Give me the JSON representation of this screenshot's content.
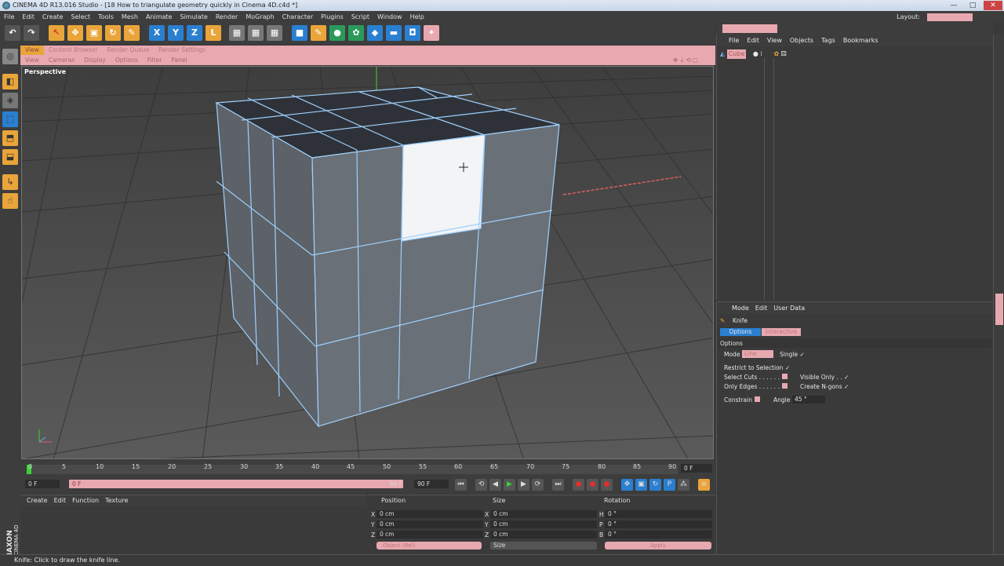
{
  "window": {
    "title": "CINEMA 4D R13.016 Studio - [18 How to triangulate geometry quickly in Cinema 4D.c4d *]",
    "minimize": "—",
    "maximize": "□",
    "close": "✕"
  },
  "menubar": [
    "File",
    "Edit",
    "Create",
    "Select",
    "Tools",
    "Mesh",
    "Animate",
    "Simulate",
    "Render",
    "MoGraph",
    "Character",
    "Plugins",
    "Script",
    "Window",
    "Help"
  ],
  "layout_label": "Layout:",
  "toolbar": {
    "undo": "↶",
    "redo": "↷",
    "live_select": "↖",
    "move": "✥",
    "scale": "▣",
    "rotate": "↻",
    "recent": "✎",
    "x_axis": "X",
    "y_axis": "Y",
    "z_axis": "Z",
    "coord_system": "L"
  },
  "viewport_tabs": [
    "View",
    "Content Browser",
    "Render Queue",
    "Render Settings"
  ],
  "viewport_menu": [
    "View",
    "Cameras",
    "Display",
    "Options",
    "Filter",
    "Panel"
  ],
  "viewport": {
    "label": "Perspective",
    "nav_icons": "✥⇣⟲▢"
  },
  "timeline": {
    "ticks": [
      "0",
      "5",
      "10",
      "15",
      "20",
      "25",
      "30",
      "35",
      "40",
      "45",
      "50",
      "55",
      "60",
      "65",
      "70",
      "75",
      "80",
      "85",
      "90"
    ],
    "frame_field": "0 F"
  },
  "transport": {
    "start": "0 F",
    "current": "0 F",
    "end1": "90 F",
    "end2": "90 F"
  },
  "material_manager": {
    "menu": [
      "Create",
      "Edit",
      "Function",
      "Texture"
    ]
  },
  "coordinates": {
    "headers": {
      "position": "Position",
      "size": "Size",
      "rotation": "Rotation"
    },
    "rows": [
      {
        "axis": "X",
        "pos": "0 cm",
        "saxis": "X",
        "size": "0 cm",
        "raxis": "H",
        "rot": "0 °"
      },
      {
        "axis": "Y",
        "pos": "0 cm",
        "saxis": "Y",
        "size": "0 cm",
        "raxis": "P",
        "rot": "0 °"
      },
      {
        "axis": "Z",
        "pos": "0 cm",
        "saxis": "Z",
        "size": "0 cm",
        "raxis": "B",
        "rot": "0 °"
      }
    ],
    "size_mode": "Size",
    "object_mode": "Object (Rel)",
    "apply": "Apply"
  },
  "object_manager": {
    "menu": [
      "File",
      "Edit",
      "View",
      "Objects",
      "Tags",
      "Bookmarks"
    ],
    "object": "Cube"
  },
  "attribute_manager": {
    "menu": [
      "Mode",
      "Edit",
      "User Data"
    ],
    "tool": "Knife",
    "tabs": [
      "Options",
      "Interactive"
    ],
    "section": "Options",
    "mode_label": "Mode",
    "mode_value": "Line",
    "single": "Single ✓",
    "restrict": "Restrict to Selection ✓",
    "select_cuts": "Select Cuts . . . . . . .",
    "visible_only": "Visible Only . . ✓",
    "only_edges": "Only Edges . . . . . . .",
    "create_ngons": "Create N-gons ✓",
    "constrain": "Constrain",
    "angle_label": "Angle",
    "angle_value": "45 °"
  },
  "statusbar": "Knife: Click to draw the knife line.",
  "brand": {
    "maxon": "MAXON",
    "product": "CINEMA 4D"
  }
}
